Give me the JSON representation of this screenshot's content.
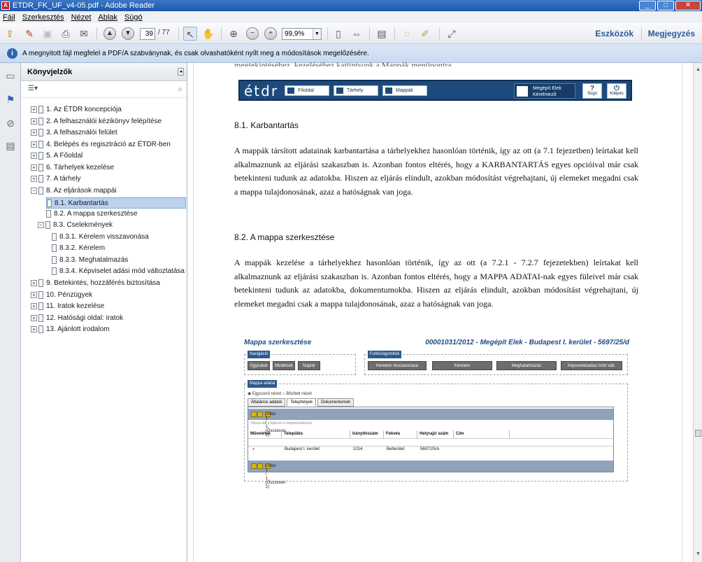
{
  "window": {
    "title": "ETDR_FK_UF_v4-05.pdf - Adobe Reader",
    "buttons": [
      "_",
      "□",
      "✕"
    ]
  },
  "menu": [
    "Fájl",
    "Szerkesztés",
    "Nézet",
    "Ablak",
    "Súgó"
  ],
  "toolbar": {
    "page_current": "39",
    "page_total": "/ 77",
    "zoom": "99,9%",
    "tools": "Eszközök",
    "comment": "Megjegyzés"
  },
  "infobar": {
    "text": "A megnyitott fájl megfelel a PDF/A szabványnak, és csak olvashatóként nyílt meg a módosítások megelőzésére."
  },
  "bookmarks": {
    "title": "Könyvjelzők",
    "items": [
      {
        "label": "1. Az ÉTDR koncepciója",
        "exp": "+",
        "level": 0
      },
      {
        "label": "2. A felhasználói kézikönyv felépítése",
        "exp": "+",
        "level": 0
      },
      {
        "label": "3. A felhasználói felület",
        "exp": "+",
        "level": 0
      },
      {
        "label": "4. Belépés és regisztráció az ÉTDR-ben",
        "exp": "+",
        "level": 0
      },
      {
        "label": "5. A Főoldal",
        "exp": "+",
        "level": 0
      },
      {
        "label": "6. Tárhelyek kezelése",
        "exp": "+",
        "level": 0
      },
      {
        "label": "7. A tárhely",
        "exp": "+",
        "level": 0
      },
      {
        "label": "8. Az eljárások mappái",
        "exp": "−",
        "level": 0
      },
      {
        "label": "8.1. Karbantartás",
        "exp": "",
        "level": 1,
        "selected": true
      },
      {
        "label": "8.2. A mappa szerkesztése",
        "exp": "",
        "level": 1
      },
      {
        "label": "8.3. Cselekmények",
        "exp": "−",
        "level": 1
      },
      {
        "label": "8.3.1. Kérelem visszavonása",
        "exp": "",
        "level": 2
      },
      {
        "label": "8.3.2. Kérelem",
        "exp": "",
        "level": 2
      },
      {
        "label": "8.3.3. Meghatalmazás",
        "exp": "",
        "level": 2
      },
      {
        "label": "8.3.4. Képviselet adási mód változtatása",
        "exp": "",
        "level": 2
      },
      {
        "label": "9. Betekintés, hozzáférés biztosítása",
        "exp": "+",
        "level": 0
      },
      {
        "label": "10. Pénzügyek",
        "exp": "+",
        "level": 0
      },
      {
        "label": "11. Iratok kezelése",
        "exp": "+",
        "level": 0
      },
      {
        "label": "12. Hatósági oldal: iratok",
        "exp": "+",
        "level": 0
      },
      {
        "label": "13. Ajánlott irodalom",
        "exp": "+",
        "level": 0
      }
    ]
  },
  "doc": {
    "cutline": "megtekintéséhez, kezeléséhez kattintsunk a Mappák menüpontra.",
    "etdr": {
      "logo": "étdr",
      "nav": [
        "Főoldal",
        "Tárhely",
        "Mappák"
      ],
      "user_name": "Megépít Elek",
      "user_role": "Kérelmező",
      "help": "Súgó",
      "logout": "Kilépés"
    },
    "h1": "8.1.  Karbantartás",
    "p1": "A mappák társított adatainak karbantartása a tárhelyekhez hasonlóan történik, így az ott (a 7.1 fejezetben) leírtakat kell alkalmaznunk az eljárási szakaszban is. Azonban fontos eltérés, hogy a KARBANTARTÁS egyes opcióival már csak betekinteni tudunk az adatokba. Hiszen az eljárás elindult, azokban módosítást végrehajtani, új elemeket megadni csak a mappa tulajdonosának, azaz a hatóságnak van joga.",
    "h2": "8.2.  A mappa szerkesztése",
    "p2": "A mappák kezelése a tárhelyekhez hasonlóan történik, így az ott (a 7.2.1 - 7.2.7 fejezetekben) leírtakat kell alkalmaznunk az eljárási szakaszban is. Azonban fontos eltérés, hogy a MAPPA ADATAI-nak egyes füleivel már csak betekinteni tudunk az adatokba, dokumentumokba. Hiszen az eljárás elindult, azokban módosítást végrehajtani, új elemeket megadni csak a mappa tulajdonosának, azaz a hatóságnak van joga.",
    "shot": {
      "title": "Mappa szerkesztése",
      "right": "00001031/2012 - Megépít Elek - Budapest I. kerület - 5697/25/d",
      "nav_legend": "Navigáció",
      "nav_btns": [
        "Ügyiratok",
        "Meldések",
        "Naptár"
      ],
      "func_legend": "Funkciógombok",
      "func_btns": [
        "Kérelem visszavonása",
        "Kérelem",
        "Meghatalmazás",
        "Képviseletadási mód vált."
      ],
      "data_legend": "Mappa adatai",
      "radio1": "Egyszerű nézet",
      "radio2": "Bővített nézet",
      "tabs": [
        "Általános adatok",
        "Telephelyek",
        "Dokumentumok"
      ],
      "pager": "Oldal: 1 / 1 (Összesen: 1)",
      "hint": "Húzza ide a fejlécet a csoportosításhoz",
      "cols": [
        "Műveletek",
        "Település",
        "Irányítószám",
        "Fekvés",
        "Helyrajzi szám",
        "Cím"
      ],
      "row": [
        "Budapest I. kerület",
        "1014",
        "Belterület",
        "5697/25/A"
      ]
    }
  }
}
